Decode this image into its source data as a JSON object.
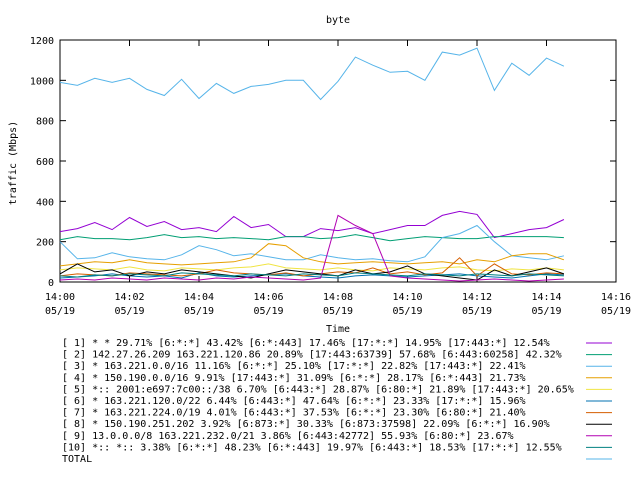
{
  "chart_data": {
    "type": "line",
    "title": "byte",
    "xlabel": "Time",
    "ylabel": "traffic (Mbps)",
    "ylim": [
      0,
      1200
    ],
    "y_ticks": [
      0,
      200,
      400,
      600,
      800,
      1000,
      1200
    ],
    "xlim": [
      0,
      16
    ],
    "x_ticks": [
      {
        "x": 0,
        "time": "14:00",
        "date": "05/19"
      },
      {
        "x": 2,
        "time": "14:02",
        "date": "05/19"
      },
      {
        "x": 4,
        "time": "14:04",
        "date": "05/19"
      },
      {
        "x": 6,
        "time": "14:06",
        "date": "05/19"
      },
      {
        "x": 8,
        "time": "14:08",
        "date": "05/19"
      },
      {
        "x": 10,
        "time": "14:10",
        "date": "05/19"
      },
      {
        "x": 12,
        "time": "14:12",
        "date": "05/19"
      },
      {
        "x": 14,
        "time": "14:14",
        "date": "05/19"
      },
      {
        "x": 16,
        "time": "14:16",
        "date": "05/19"
      }
    ],
    "grid": false,
    "legend_position": "bottom",
    "series": [
      {
        "name": "[ 1] * * 29.71%  [6:*:*] 43.42% [6:*:443] 17.46% [17:*:*] 14.95% [17:443:*] 12.54%",
        "color": "#9400d3",
        "x": [
          0,
          0.5,
          1,
          1.5,
          2,
          2.5,
          3,
          3.5,
          4,
          4.5,
          5,
          5.5,
          6,
          6.5,
          7,
          7.5,
          8,
          8.5,
          9,
          9.5,
          10,
          10.5,
          11,
          11.5,
          12,
          12.5,
          13,
          13.5,
          14,
          14.5
        ],
        "values": [
          250,
          265,
          295,
          260,
          320,
          275,
          300,
          260,
          270,
          250,
          325,
          270,
          285,
          225,
          225,
          265,
          255,
          270,
          240,
          260,
          280,
          280,
          330,
          350,
          335,
          220,
          240,
          260,
          270,
          310
        ]
      },
      {
        "name": "[ 2] 142.27.26.209 163.221.120.86 20.89%  [17:443:63739] 57.68% [6:443:60258] 42.32%",
        "color": "#009e73",
        "x": [
          0,
          0.5,
          1,
          1.5,
          2,
          2.5,
          3,
          3.5,
          4,
          4.5,
          5,
          5.5,
          6,
          6.5,
          7,
          7.5,
          8,
          8.5,
          9,
          9.5,
          10,
          10.5,
          11,
          11.5,
          12,
          12.5,
          13,
          13.5,
          14,
          14.5
        ],
        "values": [
          210,
          225,
          215,
          215,
          210,
          220,
          235,
          220,
          225,
          215,
          220,
          215,
          210,
          225,
          225,
          215,
          220,
          235,
          220,
          205,
          215,
          225,
          220,
          215,
          215,
          225,
          225,
          225,
          225,
          220
        ]
      },
      {
        "name": "[ 3] * 163.221.0.0/16 11.16%  [6:*:*] 25.10% [17:*:*] 22.82% [17:443:*] 22.41%",
        "color": "#56b4e9",
        "x": [
          0,
          0.5,
          1,
          1.5,
          2,
          2.5,
          3,
          3.5,
          4,
          4.5,
          5,
          5.5,
          6,
          6.5,
          7,
          7.5,
          8,
          8.5,
          9,
          9.5,
          10,
          10.5,
          11,
          11.5,
          12,
          12.5,
          13,
          13.5,
          14,
          14.5
        ],
        "values": [
          200,
          115,
          120,
          145,
          125,
          115,
          110,
          135,
          180,
          160,
          130,
          140,
          125,
          110,
          110,
          135,
          120,
          110,
          115,
          105,
          100,
          125,
          220,
          240,
          280,
          200,
          130,
          120,
          110,
          130
        ]
      },
      {
        "name": "[ 4] * 150.190.0.0/16 9.91%  [17:443:*] 31.09% [6:*:*] 28.17% [6:*:443] 21.73%",
        "color": "#e69f00",
        "x": [
          0,
          0.5,
          1,
          1.5,
          2,
          2.5,
          3,
          3.5,
          4,
          4.5,
          5,
          5.5,
          6,
          6.5,
          7,
          7.5,
          8,
          8.5,
          9,
          9.5,
          10,
          10.5,
          11,
          11.5,
          12,
          12.5,
          13,
          13.5,
          14,
          14.5
        ],
        "values": [
          80,
          90,
          100,
          95,
          110,
          95,
          90,
          85,
          90,
          95,
          100,
          120,
          190,
          180,
          120,
          100,
          90,
          95,
          100,
          95,
          90,
          95,
          100,
          90,
          110,
          100,
          130,
          140,
          140,
          110
        ]
      },
      {
        "name": "[ 5] *:: 2001:e697:7c00::/38 6.70%  [6:443:*] 28.87% [6:80:*] 21.89% [17:443:*] 20.65%",
        "color": "#f0e442",
        "x": [
          0,
          0.5,
          1,
          1.5,
          2,
          2.5,
          3,
          3.5,
          4,
          4.5,
          5,
          5.5,
          6,
          6.5,
          7,
          7.5,
          8,
          8.5,
          9,
          9.5,
          10,
          10.5,
          11,
          11.5,
          12,
          12.5,
          13,
          13.5,
          14,
          14.5
        ],
        "values": [
          60,
          70,
          65,
          60,
          75,
          60,
          55,
          70,
          65,
          60,
          70,
          75,
          90,
          70,
          65,
          60,
          70,
          60,
          55,
          70,
          65,
          60,
          70,
          75,
          60,
          55,
          65,
          60,
          70,
          60
        ]
      },
      {
        "name": "[ 6] * 163.221.120.0/22 6.44%  [6:443:*] 47.64% [6:*:*] 23.33% [17:*:*] 15.96%",
        "color": "#0072b2",
        "x": [
          0,
          0.5,
          1,
          1.5,
          2,
          2.5,
          3,
          3.5,
          4,
          4.5,
          5,
          5.5,
          6,
          6.5,
          7,
          7.5,
          8,
          8.5,
          9,
          9.5,
          10,
          10.5,
          11,
          11.5,
          12,
          12.5,
          13,
          13.5,
          14,
          14.5
        ],
        "values": [
          20,
          25,
          30,
          40,
          30,
          25,
          30,
          20,
          45,
          30,
          25,
          30,
          35,
          40,
          30,
          25,
          20,
          30,
          35,
          30,
          25,
          30,
          35,
          40,
          30,
          25,
          20,
          30,
          40,
          35
        ]
      },
      {
        "name": "[ 7] * 163.221.224.0/19 4.01%  [6:443:*] 37.53% [6:*:*] 23.30% [6:80:*] 21.40%",
        "color": "#d55e00",
        "x": [
          0,
          0.5,
          1,
          1.5,
          2,
          2.5,
          3,
          3.5,
          4,
          4.5,
          5,
          5.5,
          6,
          6.5,
          7,
          7.5,
          8,
          8.5,
          9,
          9.5,
          10,
          10.5,
          11,
          11.5,
          12,
          12.5,
          13,
          13.5,
          14,
          14.5
        ],
        "values": [
          30,
          40,
          35,
          30,
          45,
          40,
          35,
          30,
          40,
          60,
          45,
          40,
          35,
          45,
          30,
          40,
          50,
          45,
          70,
          40,
          50,
          35,
          45,
          120,
          30,
          90,
          40,
          35,
          45,
          40
        ]
      },
      {
        "name": "[ 8] * 150.190.251.202 3.92%  [6:873:*] 30.33% [6:873:37598] 22.09% [6:*:*] 16.90%",
        "color": "#000000",
        "x": [
          0,
          0.5,
          1,
          1.5,
          2,
          2.5,
          3,
          3.5,
          4,
          4.5,
          5,
          5.5,
          6,
          6.5,
          7,
          7.5,
          8,
          8.5,
          9,
          9.5,
          10,
          10.5,
          11,
          11.5,
          12,
          12.5,
          13,
          13.5,
          14,
          14.5
        ],
        "values": [
          40,
          90,
          50,
          60,
          30,
          50,
          40,
          60,
          50,
          40,
          30,
          20,
          40,
          60,
          50,
          40,
          30,
          60,
          40,
          50,
          80,
          40,
          30,
          20,
          10,
          60,
          30,
          50,
          70,
          40
        ]
      },
      {
        "name": "[ 9] 13.0.0.0/8 163.221.232.0/21 3.86%  [6:443:42772] 55.93% [6:80:*] 23.67%",
        "color": "#b200b2",
        "x": [
          0,
          0.5,
          1,
          1.5,
          2,
          2.5,
          3,
          3.5,
          4,
          4.5,
          5,
          5.5,
          6,
          6.5,
          7,
          7.5,
          8,
          8.5,
          9,
          9.5,
          10,
          10.5,
          11,
          11.5,
          12,
          12.5,
          13,
          13.5,
          14,
          14.5
        ],
        "values": [
          10,
          15,
          10,
          20,
          15,
          10,
          20,
          15,
          10,
          20,
          15,
          25,
          20,
          15,
          10,
          20,
          330,
          280,
          240,
          30,
          20,
          15,
          10,
          5,
          10,
          15,
          10,
          5,
          10,
          15
        ]
      },
      {
        "name": "[10] *:: *:: 3.38%  [6:*:*] 48.23% [6:*:443] 19.97% [6:443:*] 18.53% [17:*:*] 12.55%",
        "color": "#008080",
        "x": [
          0,
          0.5,
          1,
          1.5,
          2,
          2.5,
          3,
          3.5,
          4,
          4.5,
          5,
          5.5,
          6,
          6.5,
          7,
          7.5,
          8,
          8.5,
          9,
          9.5,
          10,
          10.5,
          11,
          11.5,
          12,
          12.5,
          13,
          13.5,
          14,
          14.5
        ],
        "values": [
          30,
          25,
          35,
          30,
          40,
          35,
          30,
          45,
          40,
          35,
          30,
          40,
          35,
          30,
          40,
          35,
          30,
          45,
          40,
          35,
          30,
          40,
          35,
          30,
          40,
          35,
          30,
          40,
          35,
          30
        ]
      },
      {
        "name": "TOTAL",
        "color": "#56b4e9",
        "x": [
          0,
          0.5,
          1,
          1.5,
          2,
          2.5,
          3,
          3.5,
          4,
          4.5,
          5,
          5.5,
          6,
          6.5,
          7,
          7.5,
          8,
          8.5,
          9,
          9.5,
          10,
          10.5,
          11,
          11.5,
          12,
          12.5,
          13,
          13.5,
          14,
          14.5
        ],
        "values": [
          990,
          975,
          1010,
          990,
          1010,
          955,
          925,
          1005,
          910,
          985,
          935,
          970,
          980,
          1000,
          1000,
          905,
          995,
          1115,
          1075,
          1040,
          1045,
          1000,
          1140,
          1125,
          1160,
          950,
          1085,
          1025,
          1110,
          1070
        ]
      }
    ]
  }
}
